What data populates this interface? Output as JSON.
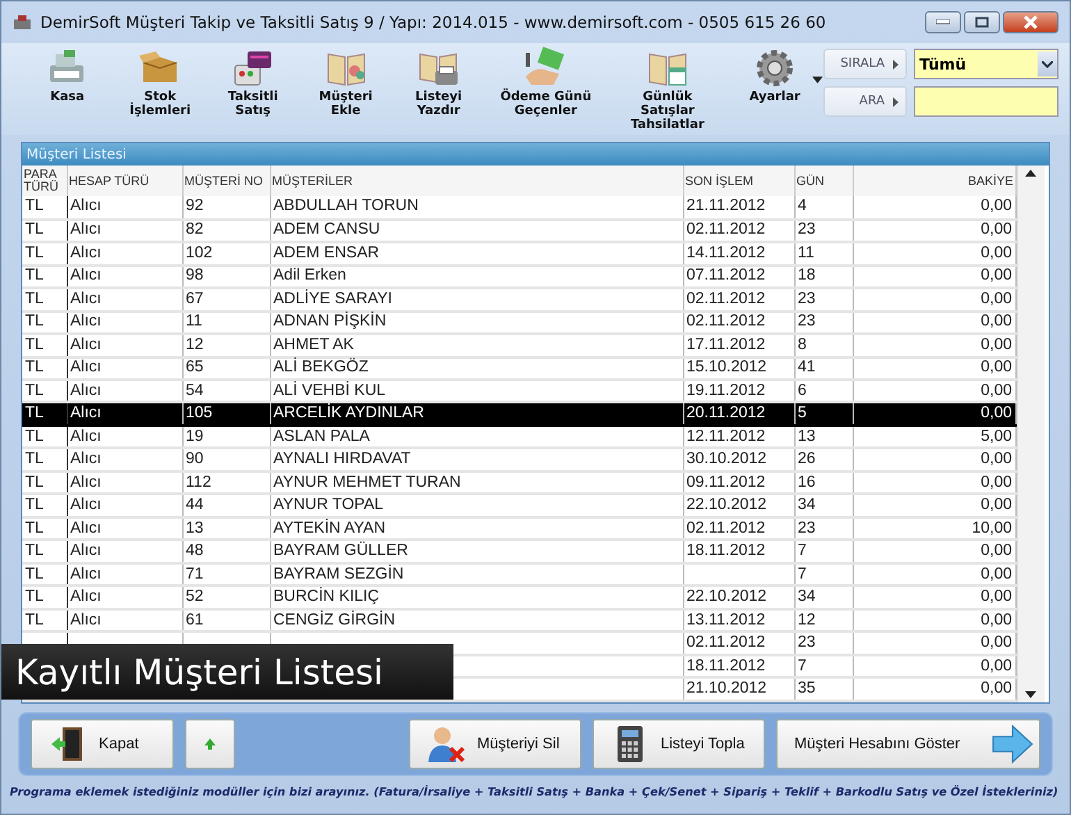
{
  "window": {
    "title": "DemirSoft Müşteri Takip ve Taksitli Satış 9 / Yapı: 2014.015 - www.demirsoft.com - 0505 615 26 60"
  },
  "toolbar": [
    {
      "label": "Kasa"
    },
    {
      "label": "Stok\nİşlemleri"
    },
    {
      "label": "Taksitli\nSatış"
    },
    {
      "label": "Müşteri\nEkle"
    },
    {
      "label": "Listeyi\nYazdır"
    },
    {
      "label": "Ödeme Günü\nGeçenler"
    },
    {
      "label": "Günlük Satışlar\nTahsilatlar"
    },
    {
      "label": "Ayarlar",
      "has_menu": true
    }
  ],
  "sort": {
    "label": "SIRALA",
    "value": "Tümü"
  },
  "search": {
    "label": "ARA"
  },
  "list": {
    "title": "Müşteri Listesi",
    "columns": [
      "PARA\nTÜRÜ",
      "HESAP TÜRÜ",
      "MÜŞTERİ NO",
      "MÜŞTERİLER",
      "SON İŞLEM",
      "GÜN",
      "BAKİYE"
    ],
    "rows": [
      {
        "para": "TL",
        "hesap": "Alıcı",
        "no": "92",
        "name": "ABDULLAH TORUN",
        "son": "21.11.2012",
        "gun": "4",
        "bakiye": "0,00",
        "selected": false
      },
      {
        "para": "TL",
        "hesap": "Alıcı",
        "no": "82",
        "name": "ADEM CANSU",
        "son": "02.11.2012",
        "gun": "23",
        "bakiye": "0,00",
        "selected": false
      },
      {
        "para": "TL",
        "hesap": "Alıcı",
        "no": "102",
        "name": "ADEM ENSAR",
        "son": "14.11.2012",
        "gun": "11",
        "bakiye": "0,00",
        "selected": false
      },
      {
        "para": "TL",
        "hesap": "Alıcı",
        "no": "98",
        "name": "Adil Erken",
        "son": "07.11.2012",
        "gun": "18",
        "bakiye": "0,00",
        "selected": false
      },
      {
        "para": "TL",
        "hesap": "Alıcı",
        "no": "67",
        "name": "ADLİYE SARAYI",
        "son": "02.11.2012",
        "gun": "23",
        "bakiye": "0,00",
        "selected": false
      },
      {
        "para": "TL",
        "hesap": "Alıcı",
        "no": "11",
        "name": "ADNAN PİŞKİN",
        "son": "02.11.2012",
        "gun": "23",
        "bakiye": "0,00",
        "selected": false
      },
      {
        "para": "TL",
        "hesap": "Alıcı",
        "no": "12",
        "name": "AHMET AK",
        "son": "17.11.2012",
        "gun": "8",
        "bakiye": "0,00",
        "selected": false
      },
      {
        "para": "TL",
        "hesap": "Alıcı",
        "no": "65",
        "name": "ALİ BEKGÖZ",
        "son": "15.10.2012",
        "gun": "41",
        "bakiye": "0,00",
        "selected": false
      },
      {
        "para": "TL",
        "hesap": "Alıcı",
        "no": "54",
        "name": "ALİ VEHBİ KUL",
        "son": "19.11.2012",
        "gun": "6",
        "bakiye": "0,00",
        "selected": false
      },
      {
        "para": "TL",
        "hesap": "Alıcı",
        "no": "105",
        "name": "ARCELİK AYDINLAR",
        "son": "20.11.2012",
        "gun": "5",
        "bakiye": "0,00",
        "selected": true
      },
      {
        "para": "TL",
        "hesap": "Alıcı",
        "no": "19",
        "name": "ASLAN PALA",
        "son": "12.11.2012",
        "gun": "13",
        "bakiye": "5,00",
        "selected": false
      },
      {
        "para": "TL",
        "hesap": "Alıcı",
        "no": "90",
        "name": "AYNALI HIRDAVAT",
        "son": "30.10.2012",
        "gun": "26",
        "bakiye": "0,00",
        "selected": false
      },
      {
        "para": "TL",
        "hesap": "Alıcı",
        "no": "112",
        "name": "AYNUR MEHMET TURAN",
        "son": "09.11.2012",
        "gun": "16",
        "bakiye": "0,00",
        "selected": false
      },
      {
        "para": "TL",
        "hesap": "Alıcı",
        "no": "44",
        "name": "AYNUR TOPAL",
        "son": "22.10.2012",
        "gun": "34",
        "bakiye": "0,00",
        "selected": false
      },
      {
        "para": "TL",
        "hesap": "Alıcı",
        "no": "13",
        "name": "AYTEKİN AYAN",
        "son": "02.11.2012",
        "gun": "23",
        "bakiye": "10,00",
        "selected": false
      },
      {
        "para": "TL",
        "hesap": "Alıcı",
        "no": "48",
        "name": "BAYRAM GÜLLER",
        "son": "18.11.2012",
        "gun": "7",
        "bakiye": "0,00",
        "selected": false
      },
      {
        "para": "TL",
        "hesap": "Alıcı",
        "no": "71",
        "name": "BAYRAM SEZGİN",
        "gun": "7",
        "bakiye": "0,00",
        "selected": false
      },
      {
        "para": "TL",
        "hesap": "Alıcı",
        "no": "52",
        "name": "BURCİN KILIÇ",
        "son": "22.10.2012",
        "gun": "34",
        "bakiye": "0,00",
        "selected": false
      },
      {
        "para": "TL",
        "hesap": "Alıcı",
        "no": "61",
        "name": "CENGİZ GİRGİN",
        "son": "13.11.2012",
        "gun": "12",
        "bakiye": "0,00",
        "selected": false
      },
      {
        "son": "02.11.2012",
        "gun": "23",
        "bakiye": "0,00",
        "selected": false
      },
      {
        "son": "18.11.2012",
        "gun": "7",
        "bakiye": "0,00",
        "selected": false
      },
      {
        "son": "21.10.2012",
        "gun": "35",
        "bakiye": "0,00",
        "selected": false
      }
    ]
  },
  "caption": "Kayıtlı Müşteri Listesi",
  "buttons": [
    {
      "label": "Kapat",
      "kind": "close"
    },
    {
      "kind": "up"
    },
    {
      "label": "Müşteriyi Sil",
      "kind": "delete"
    },
    {
      "label": "Listeyi Topla",
      "kind": "sum"
    },
    {
      "label": "Müşteri Hesabını Göster",
      "kind": "show"
    }
  ],
  "footer": "Programa eklemek istediğiniz modüller için bizi arayınız. (Fatura/İrsaliye + Taksitli Satış + Banka + Çek/Senet + Sipariş + Teklif + Barkodlu Satış ve Özel İstekleriniz)"
}
